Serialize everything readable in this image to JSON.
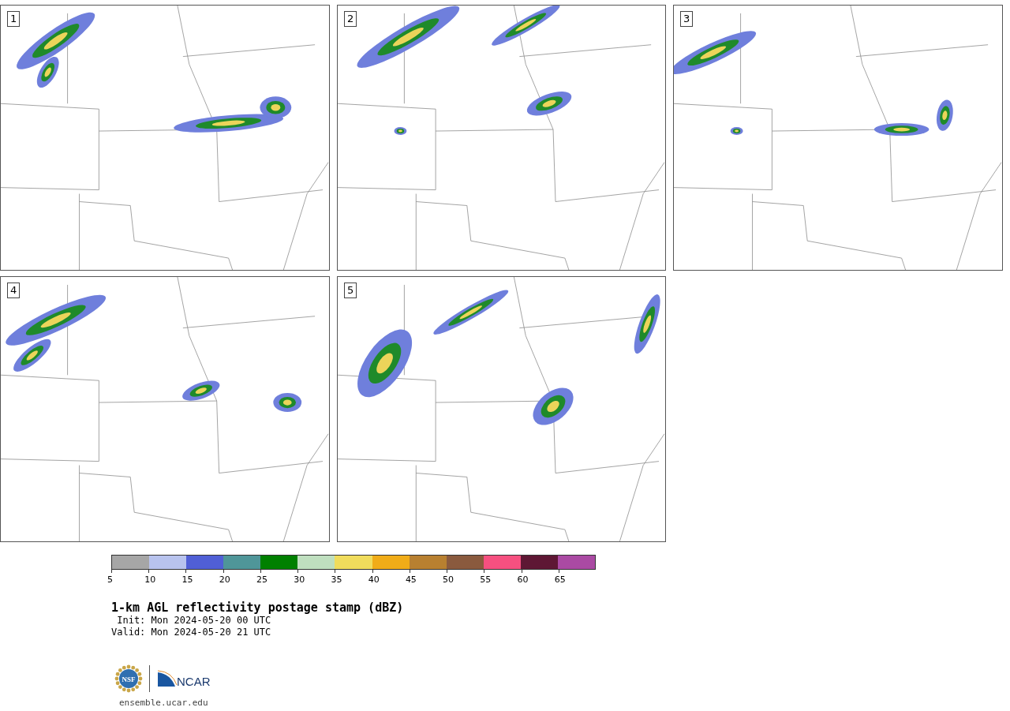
{
  "panels": [
    {
      "label": "1"
    },
    {
      "label": "2"
    },
    {
      "label": "3"
    },
    {
      "label": "4"
    },
    {
      "label": "5"
    }
  ],
  "colorbar": {
    "bins": [
      {
        "color": "#a6a6a6",
        "label": "5"
      },
      {
        "color": "#b8c3ee",
        "label": "10"
      },
      {
        "color": "#505fd6",
        "label": "15"
      },
      {
        "color": "#4f9699",
        "label": "20"
      },
      {
        "color": "#008000",
        "label": "25"
      },
      {
        "color": "#bfdfbf",
        "label": "30"
      },
      {
        "color": "#f0dc5c",
        "label": "35"
      },
      {
        "color": "#f0ac18",
        "label": "40"
      },
      {
        "color": "#b88030",
        "label": "45"
      },
      {
        "color": "#8a5a3e",
        "label": "50"
      },
      {
        "color": "#f65080",
        "label": "55"
      },
      {
        "color": "#5e1734",
        "label": "60"
      },
      {
        "color": "#aa4aa3",
        "label": "65"
      }
    ]
  },
  "title": "1-km AGL reflectivity postage stamp (dBZ)",
  "init": " Init: Mon 2024-05-20 00 UTC",
  "valid": "Valid: Mon 2024-05-20 21 UTC",
  "logos": {
    "nsf": "NSF",
    "ncar": "NCAR"
  },
  "url": "ensemble.ucar.edu"
}
